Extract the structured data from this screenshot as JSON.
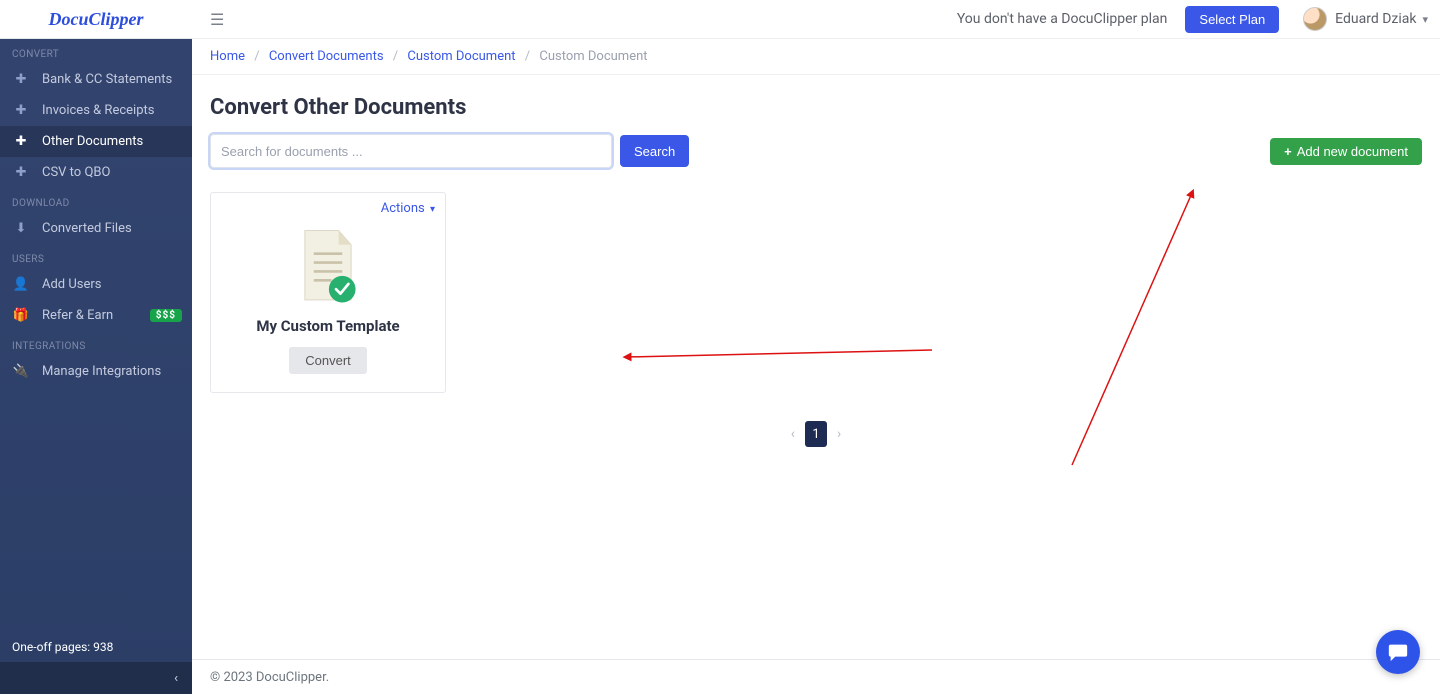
{
  "brand": "DocuClipper",
  "topbar": {
    "plan_text": "You don't have a DocuClipper plan",
    "select_plan": "Select Plan",
    "user_name": "Eduard Dziak"
  },
  "breadcrumbs": {
    "home": "Home",
    "convert": "Convert Documents",
    "custom": "Custom Document",
    "current": "Custom Document"
  },
  "sidebar": {
    "sections": {
      "convert": "CONVERT",
      "download": "DOWNLOAD",
      "users": "USERS",
      "integrations": "INTEGRATIONS"
    },
    "items": {
      "bank": "Bank & CC Statements",
      "invoices": "Invoices & Receipts",
      "other": "Other Documents",
      "csvqbo": "CSV to QBO",
      "converted": "Converted Files",
      "addusers": "Add Users",
      "refer": "Refer & Earn",
      "refer_badge": "$$$",
      "integrations": "Manage Integrations"
    },
    "footer": "One-off pages: 938"
  },
  "page": {
    "title": "Convert Other Documents",
    "search_placeholder": "Search for documents ...",
    "search_button": "Search",
    "add_document": "Add new document"
  },
  "card": {
    "actions": "Actions",
    "title": "My Custom Template",
    "convert": "Convert"
  },
  "pagination": {
    "current": "1"
  },
  "footer": {
    "text": "© 2023 DocuClipper."
  }
}
